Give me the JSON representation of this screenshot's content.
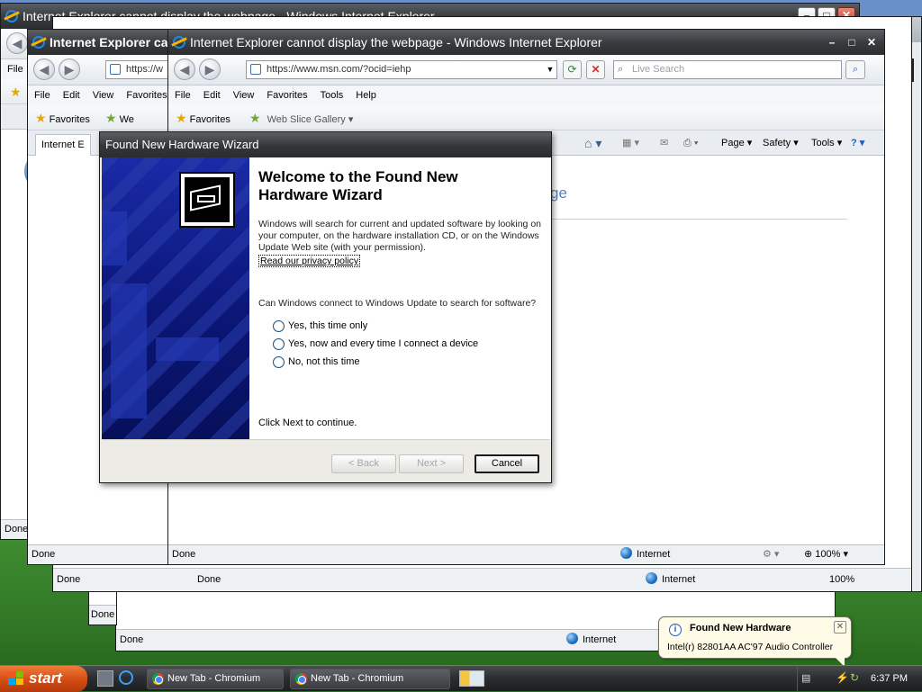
{
  "windows": {
    "back_title": "Internet Explorer cannot display the webpage - Windows Internet Explorer",
    "mid_title": "Internet Explorer cannot display the webpage",
    "front_title": "Internet Explorer cannot display the webpage - Windows Internet Explorer",
    "address_url": "https://www.msn.com/?ocid=iehp",
    "address_partial": "https://w",
    "search_placeholder": "Live Search",
    "menu": [
      "File",
      "Edit",
      "View",
      "Favorites",
      "Tools",
      "Help"
    ],
    "favorites_label": "Favorites",
    "web_slice_label": "Web Slice Gallery",
    "tab_label": "Internet E",
    "tab_partial": "We",
    "page_button": "Page",
    "safety_button": "Safety",
    "tools_button": "Tools",
    "page_partial_text": "ge",
    "status_done": "Done",
    "status_zone": "Internet",
    "zoom": "100%"
  },
  "wizard": {
    "title": "Found New Hardware Wizard",
    "heading": "Welcome to the Found New Hardware Wizard",
    "intro": "Windows will search for current and updated software by looking on your computer, on the hardware installation CD, or on the Windows Update Web site (with your permission).",
    "privacy_link": "Read our privacy policy",
    "question": "Can Windows connect to Windows Update to search for software?",
    "options": [
      "Yes, this time only",
      "Yes, now and every time I connect a device",
      "No, not this time"
    ],
    "footer_text": "Click Next to continue.",
    "back_button": "< Back",
    "next_button": "Next >",
    "cancel_button": "Cancel"
  },
  "balloon": {
    "title": "Found New Hardware",
    "text": "Intel(r) 82801AA AC'97 Audio Controller"
  },
  "taskbar": {
    "start_label": "start",
    "tasks": [
      "New Tab - Chromium",
      "New Tab - Chromium"
    ],
    "clock": "6:37 PM"
  }
}
